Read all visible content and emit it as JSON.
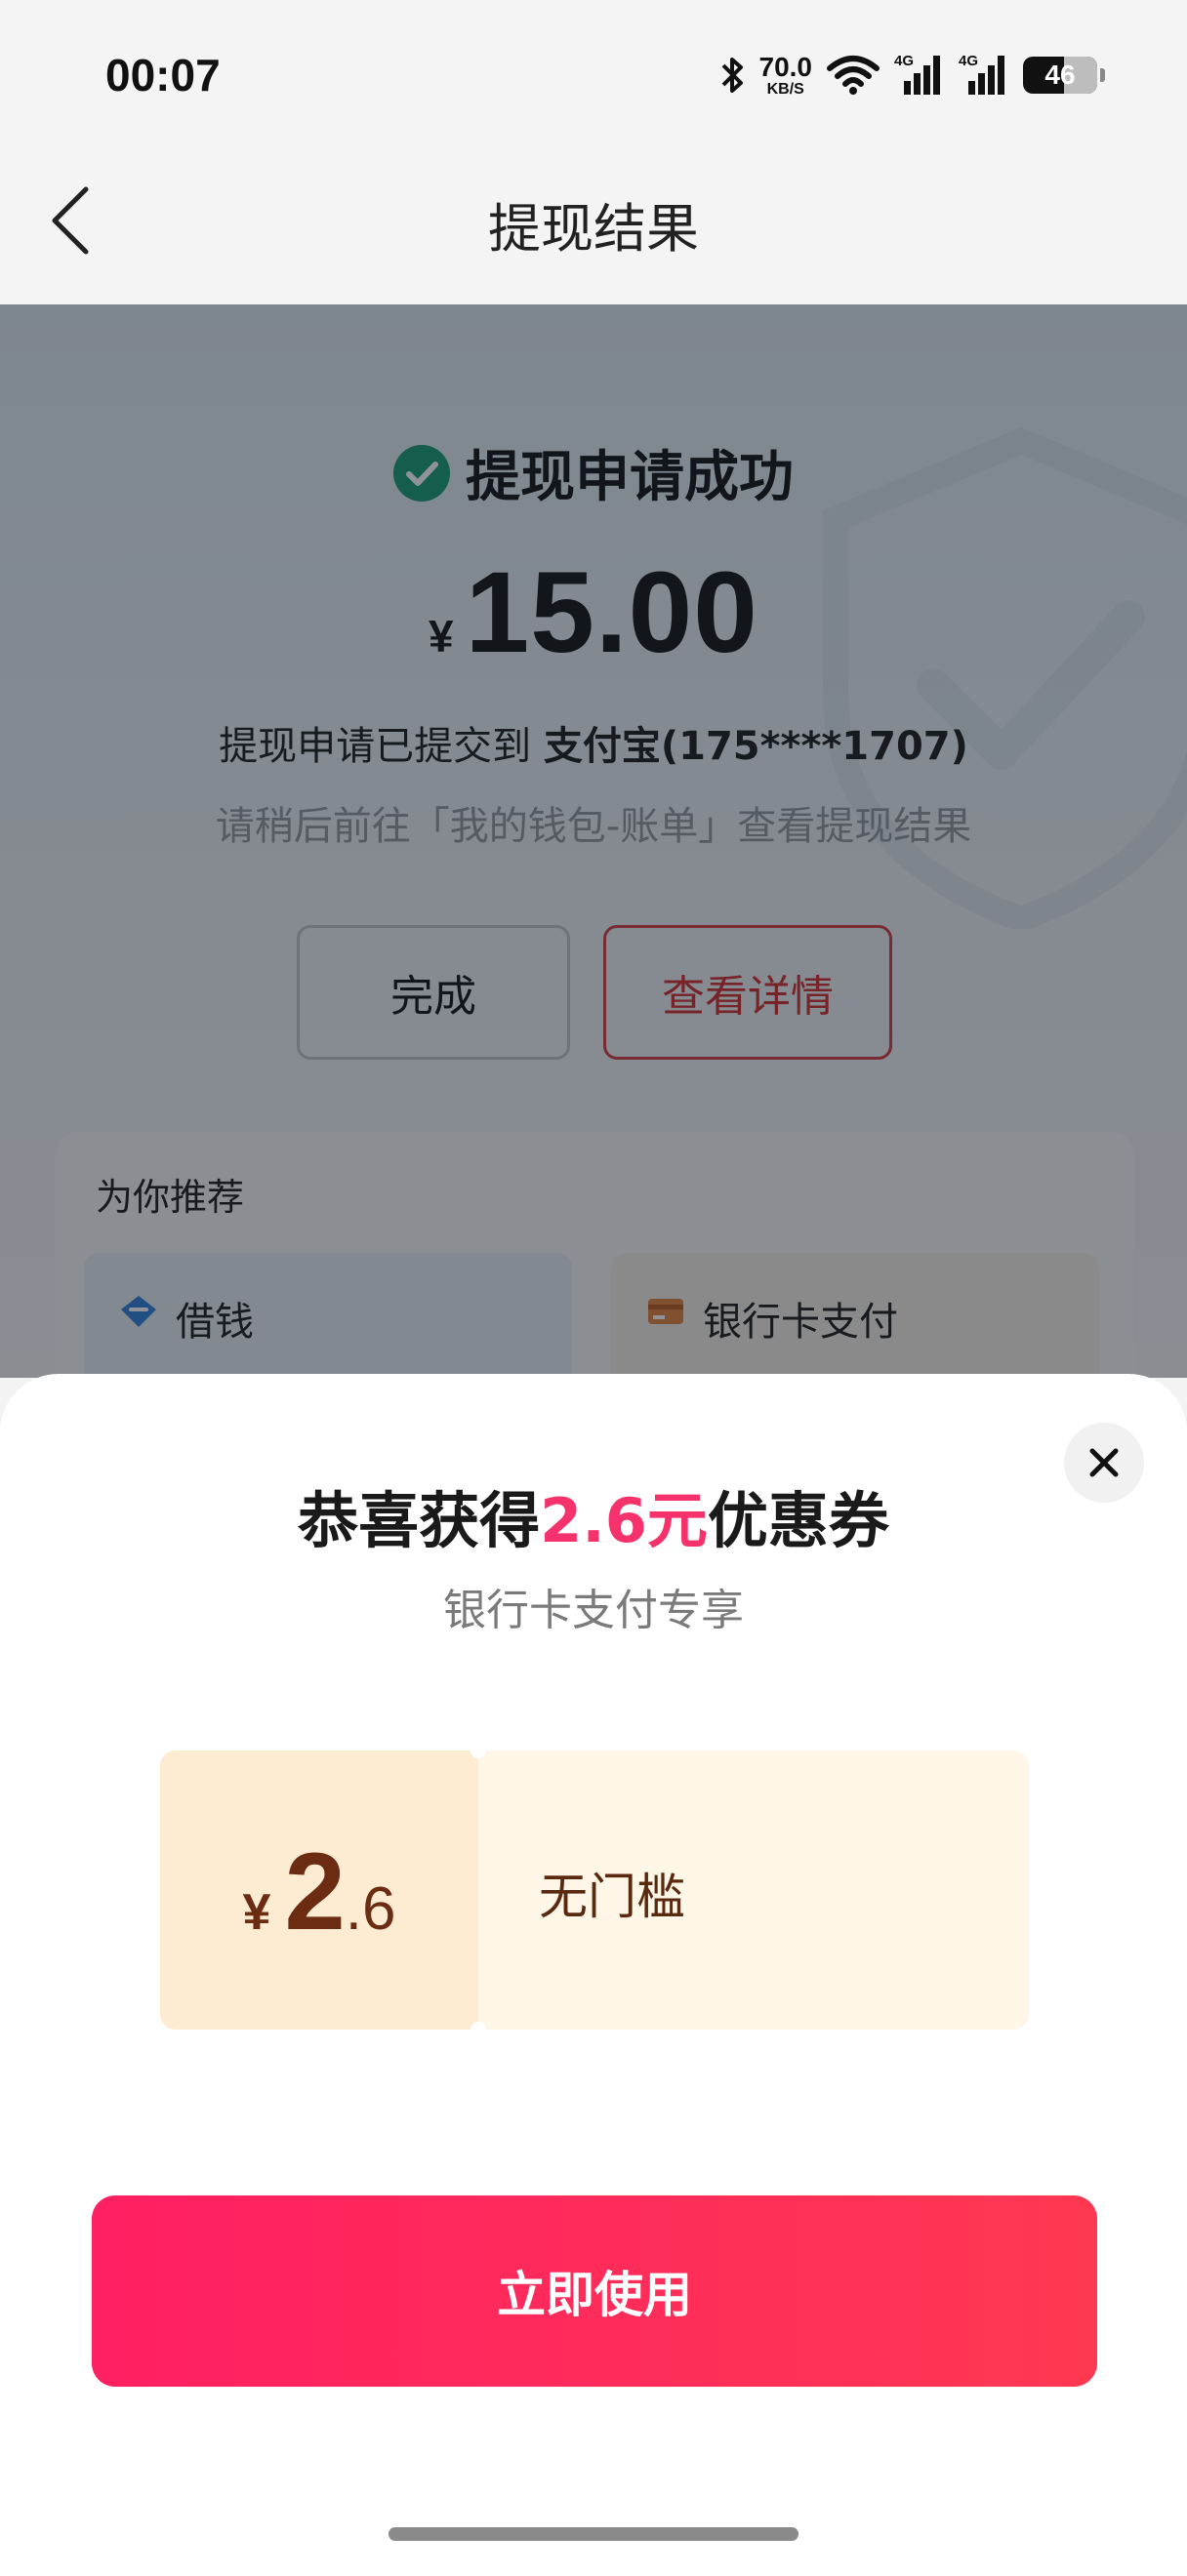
{
  "status_bar": {
    "time": "00:07",
    "net_speed_value": "70.0",
    "net_speed_unit": "KB/S",
    "signal_1_label": "4G",
    "signal_2_label": "4G",
    "battery": "46"
  },
  "nav": {
    "title": "提现结果",
    "icons": {
      "back": "chevron-left-icon"
    }
  },
  "result": {
    "status_text": "提现申请成功",
    "currency_symbol": "¥",
    "amount": "15.00",
    "submitted_prefix": "提现申请已提交到 ",
    "submitted_account": "支付宝(175****1707)",
    "hint": "请稍后前往「我的钱包-账单」查看提现结果",
    "done_label": "完成",
    "detail_label": "查看详情"
  },
  "recommend": {
    "title": "为你推荐",
    "items": [
      {
        "label": "借钱",
        "icon": "diamond-icon"
      },
      {
        "label": "银行卡支付",
        "icon": "card-icon"
      }
    ]
  },
  "sheet": {
    "title_prefix": "恭喜获得",
    "title_highlight": "2.6元",
    "title_suffix": "优惠券",
    "subtitle": "银行卡支付专享",
    "coupon": {
      "currency_symbol": "¥",
      "value_int": "2",
      "value_dec": ".6",
      "condition": "无门槛"
    },
    "use_label": "立即使用"
  },
  "colors": {
    "accent_pink": "#f5326b",
    "success_green": "#169c72",
    "detail_red": "#d12c2c",
    "coupon_text": "#6b2c12"
  }
}
